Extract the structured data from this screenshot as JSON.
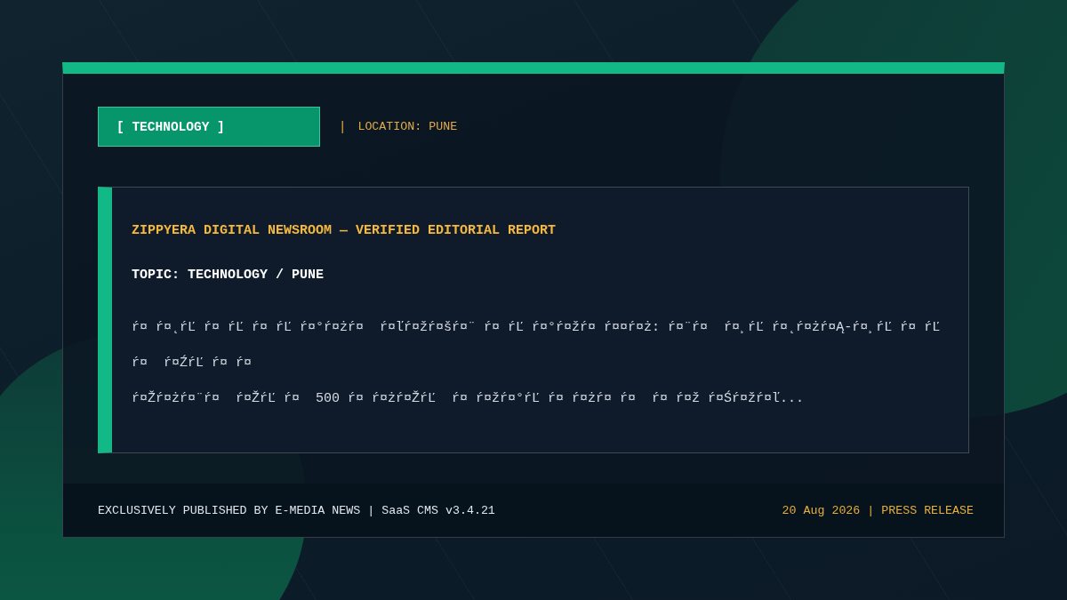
{
  "header": {
    "category_tag": "[ TECHNOLOGY ]",
    "separator": "|",
    "location": "LOCATION: PUNE"
  },
  "article_card": {
    "source_line": "ZIPPYERA DIGITAL NEWSROOM — VERIFIED EDITORIAL REPORT",
    "topic": "TOPIC: TECHNOLOGY / PUNE",
    "excerpt_lines": [
      "ŕ¤ ŕ¤˛ŕĽ ŕ¤ ŕĽ ŕ¤ ŕĽ ŕ¤°ŕ¤żŕ¤  ŕ¤ľŕ¤žŕ¤šŕ¤¨ ŕ¤ ŕĽ ŕ¤°ŕ¤žŕ¤ ŕ¤¤ŕ¤ż: ŕ¤¨ŕ¤  ŕ¤¸ŕĽ ŕ¤˛ŕ¤żŕ¤Ą-ŕ¤¸ŕĽ ŕ¤ ŕĽ ŕ¤  ŕ¤ŹŕĽ ŕ¤ ŕ¤",
      "ŕ¤Žŕ¤żŕ¤¨ŕ¤  ŕ¤ŽŕĽ ŕ¤  500 ŕ¤ ŕ¤żŕ¤ŽŕĽ  ŕ¤ ŕ¤žŕ¤°ŕĽ ŕ¤ ŕ¤żŕ¤ ŕ¤  ŕ¤ ŕ¤ž ŕ¤Śŕ¤žŕ¤ľ..."
    ]
  },
  "footer": {
    "publisher": "EXCLUSIVELY PUBLISHED BY E-MEDIA NEWS | SaaS CMS v3.4.21",
    "date_and_type": "20 Aug 2026 | PRESS RELEASE"
  }
}
